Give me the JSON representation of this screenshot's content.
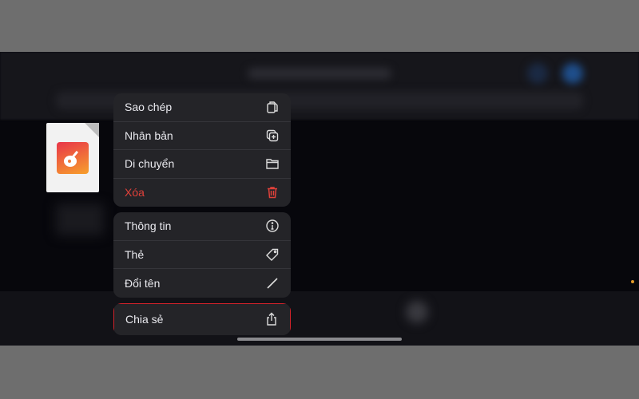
{
  "menu": {
    "group1": [
      {
        "label": "Sao chép",
        "icon": "copy-icon"
      },
      {
        "label": "Nhân bản",
        "icon": "duplicate-icon"
      },
      {
        "label": "Di chuyển",
        "icon": "folder-icon"
      },
      {
        "label": "Xóa",
        "icon": "trash-icon",
        "destructive": true
      }
    ],
    "group2": [
      {
        "label": "Thông tin",
        "icon": "info-icon"
      },
      {
        "label": "Thẻ",
        "icon": "tag-icon"
      },
      {
        "label": "Đổi tên",
        "icon": "pencil-icon"
      }
    ],
    "share": {
      "label": "Chia sẻ",
      "icon": "share-icon",
      "highlighted": true
    }
  },
  "colors": {
    "destructive": "#e0413a",
    "highlight_border": "#d3222a",
    "menu_bg": "#242428"
  }
}
